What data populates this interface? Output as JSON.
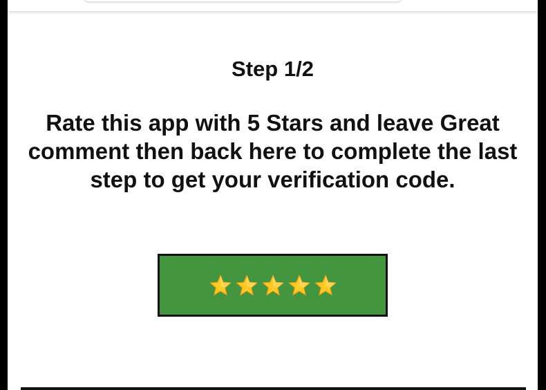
{
  "step": {
    "title": "Step 1/2"
  },
  "instructions": {
    "text": "Rate this app with 5 Stars and leave Great comment then back here to complete the last step to get your verification code."
  },
  "rate_button": {
    "star_icons": [
      "star-icon",
      "star-icon",
      "star-icon",
      "star-icon",
      "star-icon"
    ],
    "rating": 5,
    "background_color": "#43963f",
    "star_color": "#ffc928"
  }
}
